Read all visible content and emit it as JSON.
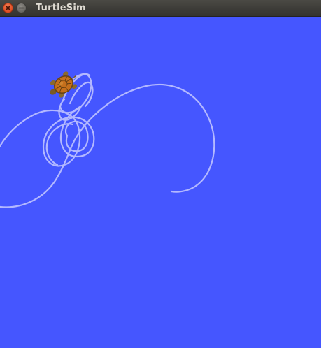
{
  "window": {
    "title": "TurtleSim",
    "buttons": {
      "close_icon": "close-icon",
      "minimize_icon": "minimize-icon"
    }
  },
  "canvas": {
    "background_color": "#4556ff",
    "pen_color": "#b3b8ff",
    "turtle_icon": "turtle-icon",
    "turtle_shell_color": "#c46f1c",
    "turtle_body_color": "#7a5a25"
  }
}
